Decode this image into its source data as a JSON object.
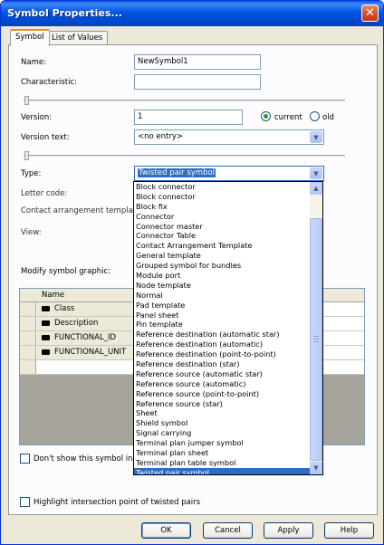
{
  "window": {
    "title": "Symbol Properties...",
    "close_label": "✕"
  },
  "tabs": [
    {
      "label": "Symbol",
      "active": true
    },
    {
      "label": "List of Values",
      "active": false
    }
  ],
  "form": {
    "name_label": "Name:",
    "name_value": "NewSymbol1",
    "characteristic_label": "Characteristic:",
    "characteristic_value": "",
    "version_label": "Version:",
    "version_value": "1",
    "radio_current": "current",
    "radio_old": "old",
    "version_text_label": "Version text:",
    "version_text_value": "<no entry>",
    "type_label": "Type:",
    "type_value": "Twisted pair symbol",
    "letter_code_label": "Letter code:",
    "contact_arrangement_label": "Contact arrangement template:",
    "view_label": "View:",
    "modify_graphic_label": "Modify symbol graphic:"
  },
  "grid": {
    "header": "Name",
    "rows": [
      "Class",
      "Description",
      "FUNCTIONAL_ID",
      "FUNCTIONAL_UNIT"
    ]
  },
  "checkboxes": {
    "dont_show": "Don't show this symbol in the",
    "highlight": "Highlight intersection point of twisted pairs"
  },
  "dropdown": {
    "items": [
      "Block connector",
      "Block connector",
      "Block fix",
      "Connector",
      "Connector master",
      "Connector Table",
      "Contact Arrangement Template",
      "General template",
      "Grouped symbol for bundles",
      "Module port",
      "Node template",
      "Normal",
      "Pad template",
      "Panel sheet",
      "Pin template",
      "Reference destination (automatic star)",
      "Reference destination (automatic)",
      "Reference destination (point-to-point)",
      "Reference destination (star)",
      "Reference source (automatic star)",
      "Reference source (automatic)",
      "Reference source (point-to-point)",
      "Reference source (star)",
      "Sheet",
      "Shield symbol",
      "Signal carrying",
      "Terminal plan jumper symbol",
      "Terminal plan sheet",
      "Terminal plan table symbol",
      "Twisted pair symbol"
    ],
    "selected": "Twisted pair symbol"
  },
  "buttons": {
    "ok": "OK",
    "cancel": "Cancel",
    "apply": "Apply",
    "help": "Help"
  },
  "icons": {
    "scroll_up": "scroll-up-icon",
    "scroll_down": "scroll-down-icon",
    "dropdown_arrow": "chevron-down-icon",
    "key": "key-icon"
  }
}
